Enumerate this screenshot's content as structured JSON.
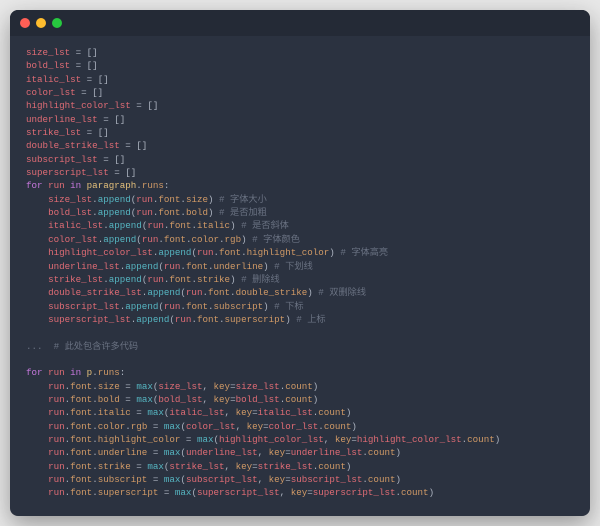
{
  "window": {
    "buttons": {
      "close": "close",
      "minimize": "minimize",
      "maximize": "maximize"
    }
  },
  "code": {
    "lines": [
      [
        [
          "var",
          "size_lst"
        ],
        [
          "op",
          " = "
        ],
        [
          "punc",
          "[]"
        ]
      ],
      [
        [
          "var",
          "bold_lst"
        ],
        [
          "op",
          " = "
        ],
        [
          "punc",
          "[]"
        ]
      ],
      [
        [
          "var",
          "italic_lst"
        ],
        [
          "op",
          " = "
        ],
        [
          "punc",
          "[]"
        ]
      ],
      [
        [
          "var",
          "color_lst"
        ],
        [
          "op",
          " = "
        ],
        [
          "punc",
          "[]"
        ]
      ],
      [
        [
          "var",
          "highlight_color_lst"
        ],
        [
          "op",
          " = "
        ],
        [
          "punc",
          "[]"
        ]
      ],
      [
        [
          "var",
          "underline_lst"
        ],
        [
          "op",
          " = "
        ],
        [
          "punc",
          "[]"
        ]
      ],
      [
        [
          "var",
          "strike_lst"
        ],
        [
          "op",
          " = "
        ],
        [
          "punc",
          "[]"
        ]
      ],
      [
        [
          "var",
          "double_strike_lst"
        ],
        [
          "op",
          " = "
        ],
        [
          "punc",
          "[]"
        ]
      ],
      [
        [
          "var",
          "subscript_lst"
        ],
        [
          "op",
          " = "
        ],
        [
          "punc",
          "[]"
        ]
      ],
      [
        [
          "var",
          "superscript_lst"
        ],
        [
          "op",
          " = "
        ],
        [
          "punc",
          "[]"
        ]
      ],
      [
        [
          "kw",
          "for"
        ],
        [
          "op",
          " "
        ],
        [
          "var",
          "run"
        ],
        [
          "op",
          " "
        ],
        [
          "kw",
          "in"
        ],
        [
          "op",
          " "
        ],
        [
          "obj",
          "paragraph"
        ],
        [
          "punc",
          "."
        ],
        [
          "attr",
          "runs"
        ],
        [
          "punc",
          ":"
        ]
      ],
      [
        [
          "op",
          "    "
        ],
        [
          "var",
          "size_lst"
        ],
        [
          "punc",
          "."
        ],
        [
          "fn",
          "append"
        ],
        [
          "punc",
          "("
        ],
        [
          "var",
          "run"
        ],
        [
          "punc",
          "."
        ],
        [
          "attr",
          "font"
        ],
        [
          "punc",
          "."
        ],
        [
          "attr",
          "size"
        ],
        [
          "punc",
          ")"
        ],
        [
          "op",
          " "
        ],
        [
          "cmt",
          "# 字体大小"
        ]
      ],
      [
        [
          "op",
          "    "
        ],
        [
          "var",
          "bold_lst"
        ],
        [
          "punc",
          "."
        ],
        [
          "fn",
          "append"
        ],
        [
          "punc",
          "("
        ],
        [
          "var",
          "run"
        ],
        [
          "punc",
          "."
        ],
        [
          "attr",
          "font"
        ],
        [
          "punc",
          "."
        ],
        [
          "attr",
          "bold"
        ],
        [
          "punc",
          ")"
        ],
        [
          "op",
          " "
        ],
        [
          "cmt",
          "# 是否加粗"
        ]
      ],
      [
        [
          "op",
          "    "
        ],
        [
          "var",
          "italic_lst"
        ],
        [
          "punc",
          "."
        ],
        [
          "fn",
          "append"
        ],
        [
          "punc",
          "("
        ],
        [
          "var",
          "run"
        ],
        [
          "punc",
          "."
        ],
        [
          "attr",
          "font"
        ],
        [
          "punc",
          "."
        ],
        [
          "attr",
          "italic"
        ],
        [
          "punc",
          ")"
        ],
        [
          "op",
          " "
        ],
        [
          "cmt",
          "# 是否斜体"
        ]
      ],
      [
        [
          "op",
          "    "
        ],
        [
          "var",
          "color_lst"
        ],
        [
          "punc",
          "."
        ],
        [
          "fn",
          "append"
        ],
        [
          "punc",
          "("
        ],
        [
          "var",
          "run"
        ],
        [
          "punc",
          "."
        ],
        [
          "attr",
          "font"
        ],
        [
          "punc",
          "."
        ],
        [
          "attr",
          "color"
        ],
        [
          "punc",
          "."
        ],
        [
          "attr",
          "rgb"
        ],
        [
          "punc",
          ")"
        ],
        [
          "op",
          " "
        ],
        [
          "cmt",
          "# 字体颜色"
        ]
      ],
      [
        [
          "op",
          "    "
        ],
        [
          "var",
          "highlight_color_lst"
        ],
        [
          "punc",
          "."
        ],
        [
          "fn",
          "append"
        ],
        [
          "punc",
          "("
        ],
        [
          "var",
          "run"
        ],
        [
          "punc",
          "."
        ],
        [
          "attr",
          "font"
        ],
        [
          "punc",
          "."
        ],
        [
          "attr",
          "highlight_color"
        ],
        [
          "punc",
          ")"
        ],
        [
          "op",
          " "
        ],
        [
          "cmt",
          "# 字体高亮"
        ]
      ],
      [
        [
          "op",
          "    "
        ],
        [
          "var",
          "underline_lst"
        ],
        [
          "punc",
          "."
        ],
        [
          "fn",
          "append"
        ],
        [
          "punc",
          "("
        ],
        [
          "var",
          "run"
        ],
        [
          "punc",
          "."
        ],
        [
          "attr",
          "font"
        ],
        [
          "punc",
          "."
        ],
        [
          "attr",
          "underline"
        ],
        [
          "punc",
          ")"
        ],
        [
          "op",
          " "
        ],
        [
          "cmt",
          "# 下划线"
        ]
      ],
      [
        [
          "op",
          "    "
        ],
        [
          "var",
          "strike_lst"
        ],
        [
          "punc",
          "."
        ],
        [
          "fn",
          "append"
        ],
        [
          "punc",
          "("
        ],
        [
          "var",
          "run"
        ],
        [
          "punc",
          "."
        ],
        [
          "attr",
          "font"
        ],
        [
          "punc",
          "."
        ],
        [
          "attr",
          "strike"
        ],
        [
          "punc",
          ")"
        ],
        [
          "op",
          " "
        ],
        [
          "cmt",
          "# 删除线"
        ]
      ],
      [
        [
          "op",
          "    "
        ],
        [
          "var",
          "double_strike_lst"
        ],
        [
          "punc",
          "."
        ],
        [
          "fn",
          "append"
        ],
        [
          "punc",
          "("
        ],
        [
          "var",
          "run"
        ],
        [
          "punc",
          "."
        ],
        [
          "attr",
          "font"
        ],
        [
          "punc",
          "."
        ],
        [
          "attr",
          "double_strike"
        ],
        [
          "punc",
          ")"
        ],
        [
          "op",
          " "
        ],
        [
          "cmt",
          "# 双删除线"
        ]
      ],
      [
        [
          "op",
          "    "
        ],
        [
          "var",
          "subscript_lst"
        ],
        [
          "punc",
          "."
        ],
        [
          "fn",
          "append"
        ],
        [
          "punc",
          "("
        ],
        [
          "var",
          "run"
        ],
        [
          "punc",
          "."
        ],
        [
          "attr",
          "font"
        ],
        [
          "punc",
          "."
        ],
        [
          "attr",
          "subscript"
        ],
        [
          "punc",
          ")"
        ],
        [
          "op",
          " "
        ],
        [
          "cmt",
          "# 下标"
        ]
      ],
      [
        [
          "op",
          "    "
        ],
        [
          "var",
          "superscript_lst"
        ],
        [
          "punc",
          "."
        ],
        [
          "fn",
          "append"
        ],
        [
          "punc",
          "("
        ],
        [
          "var",
          "run"
        ],
        [
          "punc",
          "."
        ],
        [
          "attr",
          "font"
        ],
        [
          "punc",
          "."
        ],
        [
          "attr",
          "superscript"
        ],
        [
          "punc",
          ")"
        ],
        [
          "op",
          " "
        ],
        [
          "cmt",
          "# 上标"
        ]
      ],
      [
        [
          "op",
          ""
        ]
      ],
      [
        [
          "cmt",
          "...  # 此处包含许多代码"
        ]
      ],
      [
        [
          "op",
          ""
        ]
      ],
      [
        [
          "kw",
          "for"
        ],
        [
          "op",
          " "
        ],
        [
          "var",
          "run"
        ],
        [
          "op",
          " "
        ],
        [
          "kw",
          "in"
        ],
        [
          "op",
          " "
        ],
        [
          "obj",
          "p"
        ],
        [
          "punc",
          "."
        ],
        [
          "attr",
          "runs"
        ],
        [
          "punc",
          ":"
        ]
      ],
      [
        [
          "op",
          "    "
        ],
        [
          "var",
          "run"
        ],
        [
          "punc",
          "."
        ],
        [
          "attr",
          "font"
        ],
        [
          "punc",
          "."
        ],
        [
          "attr",
          "size"
        ],
        [
          "op",
          " = "
        ],
        [
          "fn",
          "max"
        ],
        [
          "punc",
          "("
        ],
        [
          "var",
          "size_lst"
        ],
        [
          "punc",
          ", "
        ],
        [
          "attr",
          "key"
        ],
        [
          "op",
          "="
        ],
        [
          "var",
          "size_lst"
        ],
        [
          "punc",
          "."
        ],
        [
          "attr",
          "count"
        ],
        [
          "punc",
          ")"
        ]
      ],
      [
        [
          "op",
          "    "
        ],
        [
          "var",
          "run"
        ],
        [
          "punc",
          "."
        ],
        [
          "attr",
          "font"
        ],
        [
          "punc",
          "."
        ],
        [
          "attr",
          "bold"
        ],
        [
          "op",
          " = "
        ],
        [
          "fn",
          "max"
        ],
        [
          "punc",
          "("
        ],
        [
          "var",
          "bold_lst"
        ],
        [
          "punc",
          ", "
        ],
        [
          "attr",
          "key"
        ],
        [
          "op",
          "="
        ],
        [
          "var",
          "bold_lst"
        ],
        [
          "punc",
          "."
        ],
        [
          "attr",
          "count"
        ],
        [
          "punc",
          ")"
        ]
      ],
      [
        [
          "op",
          "    "
        ],
        [
          "var",
          "run"
        ],
        [
          "punc",
          "."
        ],
        [
          "attr",
          "font"
        ],
        [
          "punc",
          "."
        ],
        [
          "attr",
          "italic"
        ],
        [
          "op",
          " = "
        ],
        [
          "fn",
          "max"
        ],
        [
          "punc",
          "("
        ],
        [
          "var",
          "italic_lst"
        ],
        [
          "punc",
          ", "
        ],
        [
          "attr",
          "key"
        ],
        [
          "op",
          "="
        ],
        [
          "var",
          "italic_lst"
        ],
        [
          "punc",
          "."
        ],
        [
          "attr",
          "count"
        ],
        [
          "punc",
          ")"
        ]
      ],
      [
        [
          "op",
          "    "
        ],
        [
          "var",
          "run"
        ],
        [
          "punc",
          "."
        ],
        [
          "attr",
          "font"
        ],
        [
          "punc",
          "."
        ],
        [
          "attr",
          "color"
        ],
        [
          "punc",
          "."
        ],
        [
          "attr",
          "rgb"
        ],
        [
          "op",
          " = "
        ],
        [
          "fn",
          "max"
        ],
        [
          "punc",
          "("
        ],
        [
          "var",
          "color_lst"
        ],
        [
          "punc",
          ", "
        ],
        [
          "attr",
          "key"
        ],
        [
          "op",
          "="
        ],
        [
          "var",
          "color_lst"
        ],
        [
          "punc",
          "."
        ],
        [
          "attr",
          "count"
        ],
        [
          "punc",
          ")"
        ]
      ],
      [
        [
          "op",
          "    "
        ],
        [
          "var",
          "run"
        ],
        [
          "punc",
          "."
        ],
        [
          "attr",
          "font"
        ],
        [
          "punc",
          "."
        ],
        [
          "attr",
          "highlight_color"
        ],
        [
          "op",
          " = "
        ],
        [
          "fn",
          "max"
        ],
        [
          "punc",
          "("
        ],
        [
          "var",
          "highlight_color_lst"
        ],
        [
          "punc",
          ", "
        ],
        [
          "attr",
          "key"
        ],
        [
          "op",
          "="
        ],
        [
          "var",
          "highlight_color_lst"
        ],
        [
          "punc",
          "."
        ],
        [
          "attr",
          "count"
        ],
        [
          "punc",
          ")"
        ]
      ],
      [
        [
          "op",
          "    "
        ],
        [
          "var",
          "run"
        ],
        [
          "punc",
          "."
        ],
        [
          "attr",
          "font"
        ],
        [
          "punc",
          "."
        ],
        [
          "attr",
          "underline"
        ],
        [
          "op",
          " = "
        ],
        [
          "fn",
          "max"
        ],
        [
          "punc",
          "("
        ],
        [
          "var",
          "underline_lst"
        ],
        [
          "punc",
          ", "
        ],
        [
          "attr",
          "key"
        ],
        [
          "op",
          "="
        ],
        [
          "var",
          "underline_lst"
        ],
        [
          "punc",
          "."
        ],
        [
          "attr",
          "count"
        ],
        [
          "punc",
          ")"
        ]
      ],
      [
        [
          "op",
          "    "
        ],
        [
          "var",
          "run"
        ],
        [
          "punc",
          "."
        ],
        [
          "attr",
          "font"
        ],
        [
          "punc",
          "."
        ],
        [
          "attr",
          "strike"
        ],
        [
          "op",
          " = "
        ],
        [
          "fn",
          "max"
        ],
        [
          "punc",
          "("
        ],
        [
          "var",
          "strike_lst"
        ],
        [
          "punc",
          ", "
        ],
        [
          "attr",
          "key"
        ],
        [
          "op",
          "="
        ],
        [
          "var",
          "strike_lst"
        ],
        [
          "punc",
          "."
        ],
        [
          "attr",
          "count"
        ],
        [
          "punc",
          ")"
        ]
      ],
      [
        [
          "op",
          "    "
        ],
        [
          "var",
          "run"
        ],
        [
          "punc",
          "."
        ],
        [
          "attr",
          "font"
        ],
        [
          "punc",
          "."
        ],
        [
          "attr",
          "subscript"
        ],
        [
          "op",
          " = "
        ],
        [
          "fn",
          "max"
        ],
        [
          "punc",
          "("
        ],
        [
          "var",
          "subscript_lst"
        ],
        [
          "punc",
          ", "
        ],
        [
          "attr",
          "key"
        ],
        [
          "op",
          "="
        ],
        [
          "var",
          "subscript_lst"
        ],
        [
          "punc",
          "."
        ],
        [
          "attr",
          "count"
        ],
        [
          "punc",
          ")"
        ]
      ],
      [
        [
          "op",
          "    "
        ],
        [
          "var",
          "run"
        ],
        [
          "punc",
          "."
        ],
        [
          "attr",
          "font"
        ],
        [
          "punc",
          "."
        ],
        [
          "attr",
          "superscript"
        ],
        [
          "op",
          " = "
        ],
        [
          "fn",
          "max"
        ],
        [
          "punc",
          "("
        ],
        [
          "var",
          "superscript_lst"
        ],
        [
          "punc",
          ", "
        ],
        [
          "attr",
          "key"
        ],
        [
          "op",
          "="
        ],
        [
          "var",
          "superscript_lst"
        ],
        [
          "punc",
          "."
        ],
        [
          "attr",
          "count"
        ],
        [
          "punc",
          ")"
        ]
      ]
    ]
  }
}
